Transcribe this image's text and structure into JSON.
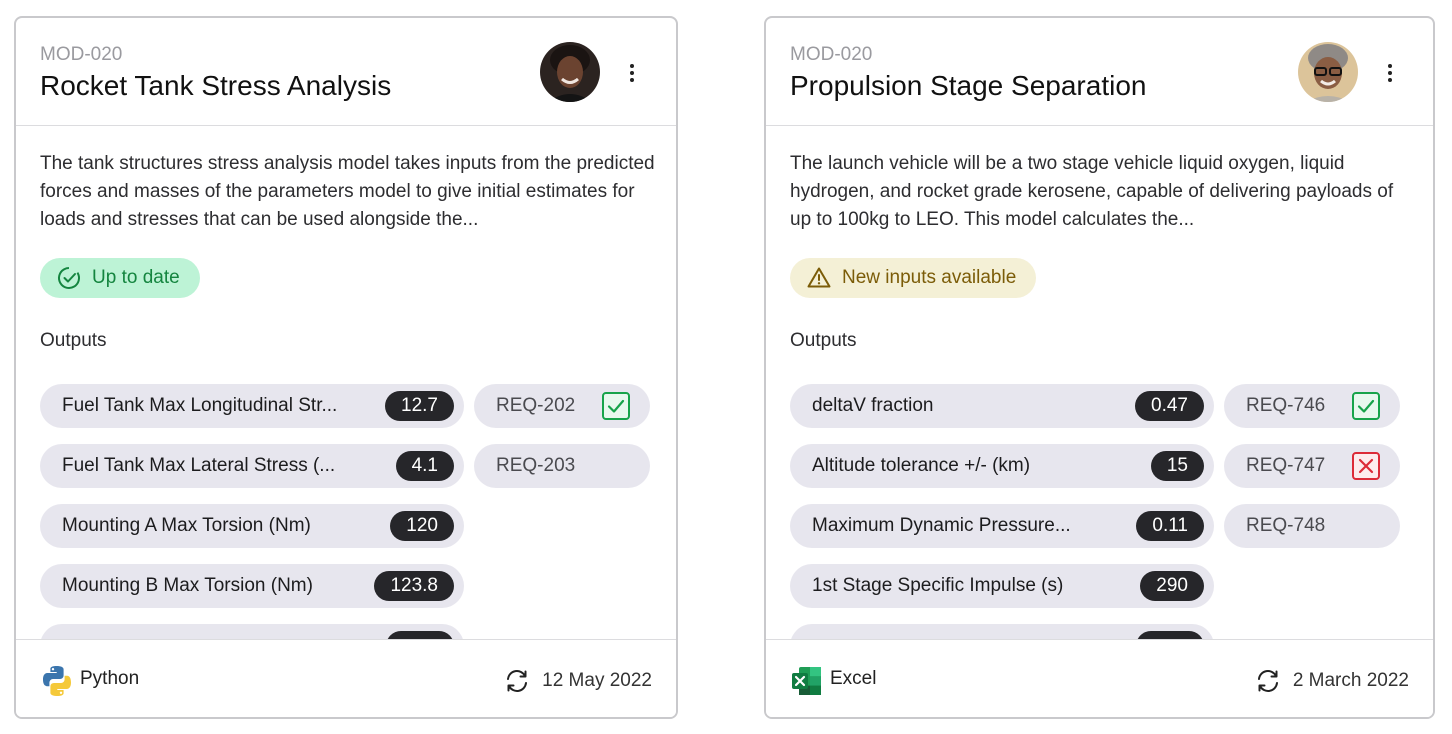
{
  "cards": [
    {
      "id": "MOD-020",
      "title": "Rocket Tank Stress Analysis",
      "description": "The tank structures stress analysis model takes inputs from the predicted forces and masses of the parameters model to give initial estimates for loads and stresses that can be used alongside the...",
      "status": {
        "label": "Up to date",
        "type": "success",
        "icon": "check-circle-icon",
        "color": "#14853f"
      },
      "outputs_label": "Outputs",
      "outputs": [
        {
          "label": "Fuel Tank Max Longitudinal Str...",
          "value": "12.7",
          "req": "REQ-202",
          "req_status": "pass"
        },
        {
          "label": "Fuel Tank Max Lateral Stress (...",
          "value": "4.1",
          "req": "REQ-203",
          "req_status": "none"
        },
        {
          "label": "Mounting A Max Torsion (Nm)",
          "value": "120"
        },
        {
          "label": "Mounting B Max Torsion (Nm)",
          "value": "123.8"
        }
      ],
      "tool": {
        "name": "Python",
        "icon": "python-icon"
      },
      "updated": {
        "date": "12 May 2022",
        "icon": "refresh-icon"
      }
    },
    {
      "id": "MOD-020",
      "title": "Propulsion Stage Separation",
      "description": "The launch vehicle will be a two stage vehicle liquid oxygen, liquid hydrogen, and rocket grade kerosene, capable of delivering payloads of up to 100kg to LEO. This model calculates the...",
      "status": {
        "label": "New inputs available",
        "type": "warning",
        "icon": "warning-icon",
        "color": "#7b5c08"
      },
      "outputs_label": "Outputs",
      "outputs": [
        {
          "label": "deltaV fraction",
          "value": "0.47",
          "req": "REQ-746",
          "req_status": "pass"
        },
        {
          "label": "Altitude tolerance +/- (km)",
          "value": "15",
          "req": "REQ-747",
          "req_status": "fail"
        },
        {
          "label": "Maximum Dynamic Pressure...",
          "value": "0.11",
          "req": "REQ-748",
          "req_status": "none"
        },
        {
          "label": "1st Stage Specific Impulse (s)",
          "value": "290"
        }
      ],
      "tool": {
        "name": "Excel",
        "icon": "excel-icon"
      },
      "updated": {
        "date": "2 March 2022",
        "icon": "refresh-icon"
      }
    }
  ]
}
